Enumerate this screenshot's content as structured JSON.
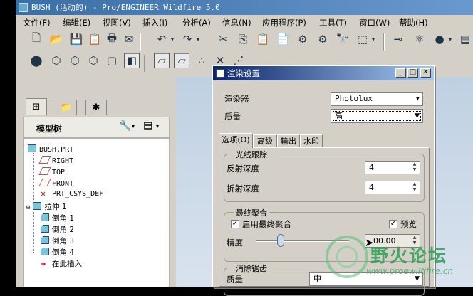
{
  "window": {
    "title": "BUSH (活动的) - Pro/ENGINEER Wildfire 5.0"
  },
  "menu": [
    "文件(F)",
    "编辑(E)",
    "视图(V)",
    "插入(I)",
    "分析(A)",
    "信息(N)",
    "应用程序(P)",
    "工具(T)",
    "窗口(W)",
    "帮助(H)"
  ],
  "model_tree": {
    "title": "模型树",
    "items": [
      {
        "label": "BUSH.PRT",
        "icon": "part-icon"
      },
      {
        "label": "RIGHT",
        "icon": "datum-plane-icon"
      },
      {
        "label": "TOP",
        "icon": "datum-plane-icon"
      },
      {
        "label": "FRONT",
        "icon": "datum-plane-icon"
      },
      {
        "label": "PRT_CSYS_DEF",
        "icon": "csys-icon"
      },
      {
        "label": "拉伸 1",
        "icon": "extrude-icon"
      },
      {
        "label": "倒角 1",
        "icon": "chamfer-icon"
      },
      {
        "label": "倒角 2",
        "icon": "chamfer-icon"
      },
      {
        "label": "倒角 3",
        "icon": "chamfer-icon"
      },
      {
        "label": "倒角 4",
        "icon": "chamfer-icon"
      },
      {
        "label": "在此插入",
        "icon": "insert-here-arrow-icon"
      }
    ]
  },
  "dialog": {
    "title": "渲染设置",
    "renderer_label": "渲染器",
    "renderer_value": "Photolux",
    "quality_label": "质量",
    "quality_value": "高",
    "tabs": [
      "选项(O)",
      "高级",
      "输出",
      "水印"
    ],
    "raytrace": {
      "group_label": "光线跟踪",
      "reflection_label": "反射深度",
      "reflection_value": "4",
      "refraction_label": "折射深度",
      "refraction_value": "4"
    },
    "final_gather": {
      "group_label": "最终聚合",
      "enable_label": "启用最终聚合",
      "enable_checked": true,
      "preview_label": "预览",
      "preview_checked": true,
      "precision_label": "精度",
      "precision_value": "00.00",
      "precision_level": 0.1
    },
    "antialias": {
      "group_label": "消除锯齿",
      "quality_label": "质量",
      "quality_value": "中"
    }
  },
  "watermark": {
    "text": "野火论坛",
    "url": "www.proewildfire.cn"
  },
  "colors": {
    "title_active": "#0a246a",
    "title_app": "#3a6ea5",
    "face": "#d4d0c8",
    "graphics_bg": "#c8d6e6"
  }
}
